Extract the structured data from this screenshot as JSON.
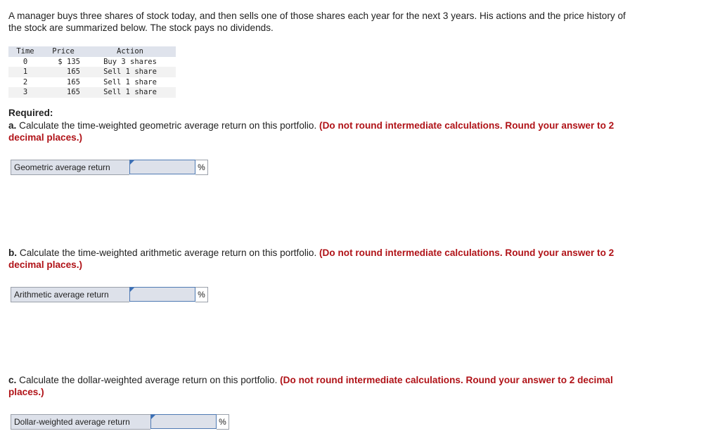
{
  "intro": "A manager buys three shares of stock today, and then sells one of those shares each year for the next 3 years. His actions and the price history of the stock are summarized below. The stock pays no dividends.",
  "table": {
    "headers": [
      "Time",
      "Price",
      "Action"
    ],
    "rows": [
      {
        "time": "0",
        "price": "$ 135",
        "action": "Buy 3 shares"
      },
      {
        "time": "1",
        "price": "165",
        "action": "Sell 1 share"
      },
      {
        "time": "2",
        "price": "165",
        "action": "Sell 1 share"
      },
      {
        "time": "3",
        "price": "165",
        "action": "Sell 1 share"
      }
    ]
  },
  "required_label": "Required:",
  "questions": [
    {
      "letter": "a.",
      "text": " Calculate the time-weighted geometric average return on this portfolio. ",
      "instruction": "(Do not round intermediate calculations. Round your answer to 2 decimal places.)",
      "answer_label": "Geometric average return",
      "answer_value": "",
      "unit": "%"
    },
    {
      "letter": "b.",
      "text": " Calculate the time-weighted arithmetic average return on this portfolio. ",
      "instruction": "(Do not round intermediate calculations. Round your answer to 2 decimal places.)",
      "answer_label": "Arithmetic average return",
      "answer_value": "",
      "unit": "%"
    },
    {
      "letter": "c.",
      "text": " Calculate the dollar-weighted average return on this portfolio. ",
      "instruction": "(Do not round intermediate calculations. Round your answer to 2 decimal places.)",
      "answer_label": "Dollar-weighted average return",
      "answer_value": "",
      "unit": "%"
    }
  ],
  "colors": {
    "instruction_red": "#b01318",
    "input_border": "#4f7ab3"
  }
}
